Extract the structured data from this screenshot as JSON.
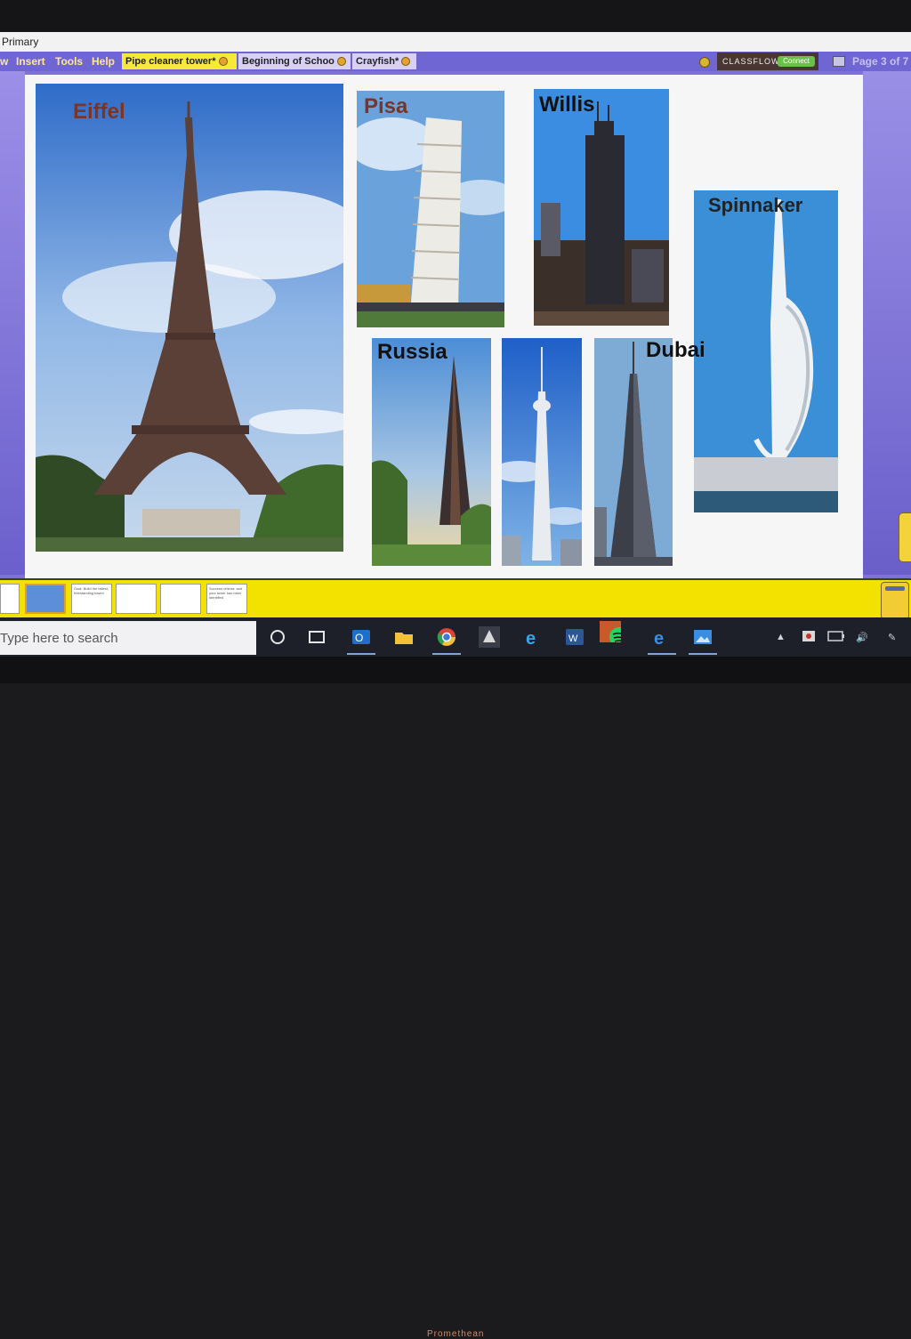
{
  "app": {
    "title": "Primary"
  },
  "menu": {
    "items": [
      "w",
      "Insert",
      "Tools",
      "Help"
    ]
  },
  "tabs": [
    {
      "label": "Pipe cleaner tower*",
      "active": true
    },
    {
      "label": "Beginning of Schoo",
      "active": false
    },
    {
      "label": "Crayfish*",
      "active": false
    }
  ],
  "classflow": {
    "brand": "CLASSFLOW",
    "connect": "Connect"
  },
  "page_indicator": "Page 3 of 7",
  "slide": {
    "photos": [
      {
        "id": "eiffel",
        "label": "Eiffel",
        "label_color": "#7a3528"
      },
      {
        "id": "pisa",
        "label": "Pisa",
        "label_color": "#7a3528"
      },
      {
        "id": "willis",
        "label": "Willis",
        "label_color": "#111111"
      },
      {
        "id": "spinnaker",
        "label": "Spinnaker",
        "label_color": "#222222"
      },
      {
        "id": "russia",
        "label": "Russia",
        "label_color": "#111111"
      },
      {
        "id": "cn",
        "label": "",
        "label_color": "#111111"
      },
      {
        "id": "dubai",
        "label": "Dubai",
        "label_color": "#111111"
      }
    ]
  },
  "slide_tray": {
    "thumbnails": [
      {
        "text": "",
        "selected": false
      },
      {
        "text": "",
        "selected": true
      },
      {
        "text": "Goal: Build the tallest, freestanding tower!",
        "selected": false
      },
      {
        "text": "",
        "selected": false
      },
      {
        "text": "",
        "selected": false
      },
      {
        "text": "Success criteria: and your tower has been identified",
        "selected": false
      }
    ]
  },
  "taskbar": {
    "search_placeholder": "Type here to search",
    "apps": [
      "task-view",
      "outlook",
      "file-explorer",
      "chrome",
      "active-app",
      "internet-explorer",
      "word",
      "spotify",
      "edge",
      "photos"
    ],
    "tray": [
      "chevron-up",
      "dropbox",
      "battery",
      "volume",
      "pen"
    ]
  },
  "monitor": {
    "brand": "Promethean"
  },
  "colors": {
    "menubar": "#6f66d4",
    "active_tab": "#f7e93a",
    "slide_tray": "#f3e200",
    "taskbar": "#1d2029",
    "page_counter": "#c8c0f0"
  }
}
